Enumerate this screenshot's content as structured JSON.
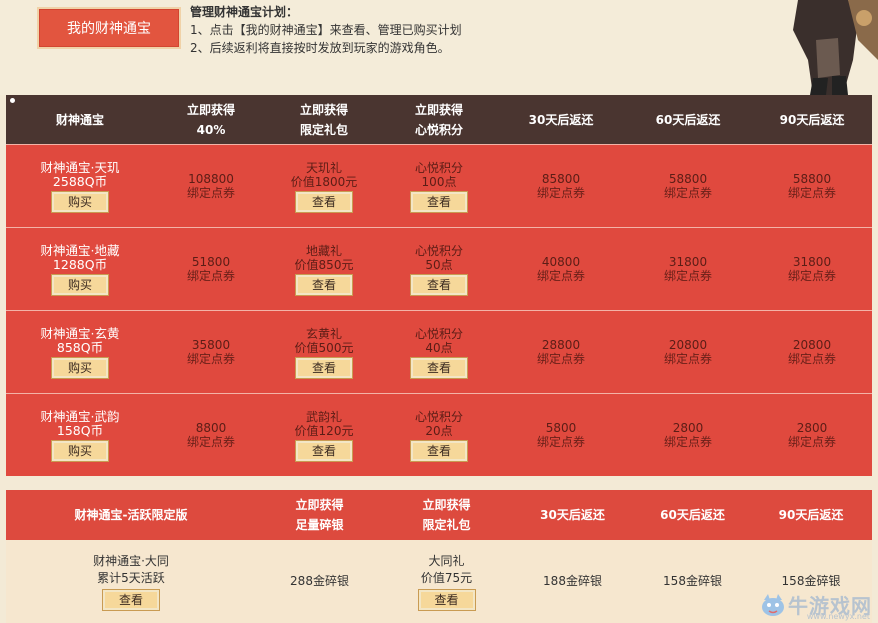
{
  "top": {
    "my_button": "我的财神通宝",
    "title": "管理财神通宝计划：",
    "line1": "1、点击【我的财神通宝】来查看、管理已购买计划",
    "line2": "2、后续返利将直接按时发放到玩家的游戏角色。"
  },
  "table1": {
    "headers": [
      {
        "l1": "财神通宝",
        "l2": ""
      },
      {
        "l1": "立即获得",
        "l2": "40%"
      },
      {
        "l1": "立即获得",
        "l2": "限定礼包"
      },
      {
        "l1": "立即获得",
        "l2": "心悦积分"
      },
      {
        "l1": "30天后返还",
        "l2": ""
      },
      {
        "l1": "60天后返还",
        "l2": ""
      },
      {
        "l1": "90天后返还",
        "l2": ""
      }
    ],
    "unit": "绑定点券",
    "buy": "购买",
    "view": "查看",
    "rows": [
      {
        "name": "财神通宝·天玑",
        "price": "2588Q币",
        "c1": "108800",
        "gift": "天玑礼",
        "gift_val": "价值1800元",
        "pts": "心悦积分",
        "pts_val": "100点",
        "r30": "85800",
        "r60": "58800",
        "r90": "58800"
      },
      {
        "name": "财神通宝·地藏",
        "price": "1288Q币",
        "c1": "51800",
        "gift": "地藏礼",
        "gift_val": "价值850元",
        "pts": "心悦积分",
        "pts_val": "50点",
        "r30": "40800",
        "r60": "31800",
        "r90": "31800"
      },
      {
        "name": "财神通宝·玄黄",
        "price": "858Q币",
        "c1": "35800",
        "gift": "玄黄礼",
        "gift_val": "价值500元",
        "pts": "心悦积分",
        "pts_val": "40点",
        "r30": "28800",
        "r60": "20800",
        "r90": "20800"
      },
      {
        "name": "财神通宝·武韵",
        "price": "158Q币",
        "c1": "8800",
        "gift": "武韵礼",
        "gift_val": "价值120元",
        "pts": "心悦积分",
        "pts_val": "20点",
        "r30": "5800",
        "r60": "2800",
        "r90": "2800"
      }
    ]
  },
  "table2": {
    "headers": [
      {
        "l1": "财神通宝-活跃限定版",
        "l2": ""
      },
      {
        "l1": "立即获得",
        "l2": "足量碎银"
      },
      {
        "l1": "立即获得",
        "l2": "限定礼包"
      },
      {
        "l1": "30天后返还",
        "l2": ""
      },
      {
        "l1": "60天后返还",
        "l2": ""
      },
      {
        "l1": "90天后返还",
        "l2": ""
      }
    ],
    "row": {
      "name": "财神通宝·大同",
      "cond": "累计5天活跃",
      "view": "查看",
      "c1": "288金碎银",
      "gift": "大同礼",
      "gift_val": "价值75元",
      "r30": "188金碎银",
      "r60": "158金碎银",
      "r90": "158金碎银"
    }
  },
  "watermark": {
    "text": "牛游戏网",
    "url": "www.newyx.net"
  }
}
